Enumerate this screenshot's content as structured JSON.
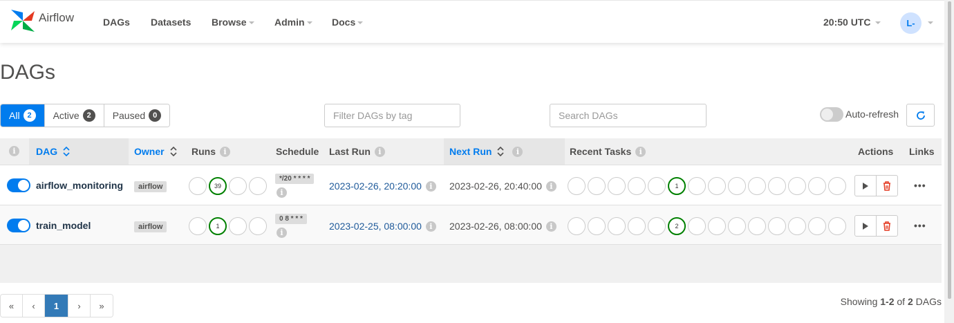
{
  "brand": {
    "name": "Airflow"
  },
  "nav": {
    "items": [
      {
        "label": "DAGs",
        "has_caret": false
      },
      {
        "label": "Datasets",
        "has_caret": false
      },
      {
        "label": "Browse",
        "has_caret": true
      },
      {
        "label": "Admin",
        "has_caret": true
      },
      {
        "label": "Docs",
        "has_caret": true
      }
    ],
    "time": "20:50 UTC",
    "user_initials": "L-"
  },
  "page": {
    "title": "DAGs"
  },
  "filters": {
    "status": [
      {
        "label": "All",
        "count": "2",
        "active": true
      },
      {
        "label": "Active",
        "count": "2",
        "active": false
      },
      {
        "label": "Paused",
        "count": "0",
        "active": false
      }
    ],
    "tag_placeholder": "Filter DAGs by tag",
    "search_placeholder": "Search DAGs",
    "auto_refresh_label": "Auto-refresh"
  },
  "table": {
    "headers": {
      "dag": "DAG",
      "owner": "Owner",
      "runs": "Runs",
      "schedule": "Schedule",
      "last_run": "Last Run",
      "next_run": "Next Run",
      "recent_tasks": "Recent Tasks",
      "actions": "Actions",
      "links": "Links"
    },
    "rows": [
      {
        "dag_id": "airflow_monitoring",
        "owner": "airflow",
        "runs_success": "39",
        "schedule": "*/20 * * * *",
        "last_run": "2023-02-26, 20:20:00",
        "next_run": "2023-02-26, 20:40:00",
        "recent_tasks_success": "1",
        "links": "•••"
      },
      {
        "dag_id": "train_model",
        "owner": "airflow",
        "runs_success": "1",
        "schedule": "0 8 * * *",
        "last_run": "2023-02-25, 08:00:00",
        "next_run": "2023-02-26, 08:00:00",
        "recent_tasks_success": "2",
        "links": "•••"
      }
    ]
  },
  "pagination": {
    "first": "«",
    "prev": "‹",
    "current": "1",
    "next": "›",
    "last": "»"
  },
  "showing": {
    "prefix": "Showing ",
    "range": "1-2",
    "middle": " of ",
    "total": "2",
    "suffix": " DAGs"
  },
  "colors": {
    "accent": "#017cee",
    "success": "#008000",
    "failed": "#ff0000"
  }
}
